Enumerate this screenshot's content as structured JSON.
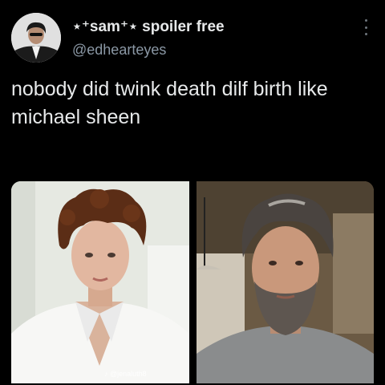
{
  "tweet": {
    "display_name": "⋆⁺sam⁺⋆ spoiler free",
    "handle": "@edhearteyes",
    "text": "nobody did twink death dilf birth like michael sheen"
  },
  "media": {
    "watermark": "♪ @jenaluth8"
  },
  "icons": {
    "more": "more-vertical-icon"
  }
}
